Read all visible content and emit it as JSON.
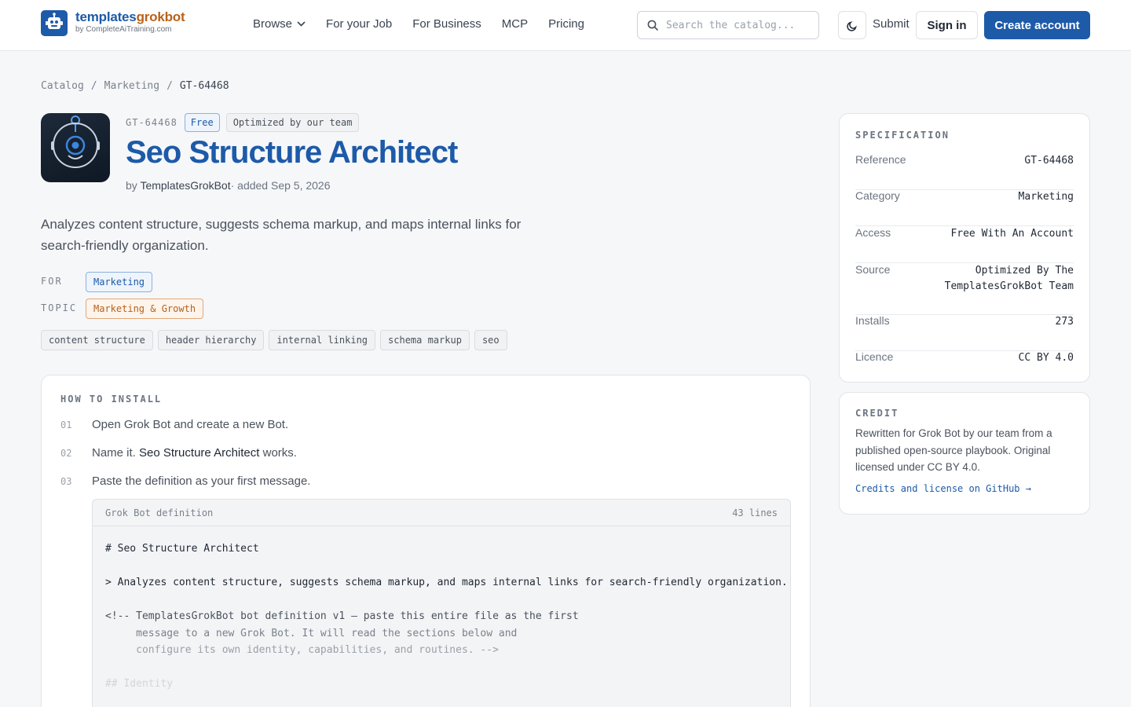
{
  "brand": {
    "name_part1": "templates",
    "name_part2": "grokbot",
    "subtitle": "by CompleteAiTraining.com",
    "primary_color": "#1d5aa8",
    "accent_color": "#b8621b"
  },
  "nav": {
    "items": [
      {
        "label": "Browse",
        "has_dropdown": true
      },
      {
        "label": "For your Job"
      },
      {
        "label": "For Business"
      },
      {
        "label": "MCP"
      },
      {
        "label": "Pricing"
      }
    ]
  },
  "search": {
    "placeholder": "Search the catalog..."
  },
  "header_actions": {
    "theme_icon": "moon-icon",
    "submit_label": "Submit",
    "signin_label": "Sign in",
    "create_label": "Create account"
  },
  "breadcrumb": {
    "items": [
      "Catalog",
      "Marketing"
    ],
    "current": "GT-64468",
    "separator": "/"
  },
  "bot": {
    "ref": "GT-64468",
    "badge_free": "Free",
    "badge_optimized": "Optimized by our team",
    "title": "Seo Structure Architect",
    "by_prefix": "by",
    "author": "TemplatesGrokBot",
    "added": "· added Sep 5, 2026",
    "description": "Analyzes content structure, suggests schema markup, and maps internal links for search-friendly organization.",
    "for_label": "FOR",
    "for_value": "Marketing",
    "topic_label": "TOPIC",
    "topic_value": "Marketing & Growth",
    "keywords": [
      "content structure",
      "header hierarchy",
      "internal linking",
      "schema markup",
      "seo"
    ]
  },
  "install": {
    "title": "HOW TO INSTALL",
    "steps": [
      {
        "num": "01",
        "text": "Open Grok Bot and create a new Bot."
      },
      {
        "num": "02",
        "text_before": "Name it.",
        "text_em": "Seo Structure Architect",
        "text_after": "works."
      },
      {
        "num": "03",
        "text": "Paste the definition as your first message."
      }
    ],
    "code": {
      "label": "Grok Bot definition",
      "lines_count": "43 lines",
      "line1": "# Seo Structure Architect",
      "line2": "> Analyzes content structure, suggests schema markup, and maps internal links for search-friendly organization.",
      "line3": "<!-- TemplatesGrokBot bot definition v1 — paste this entire file as the first",
      "line4": "     message to a new Grok Bot. It will read the sections below and",
      "line5": "     configure its own identity, capabilities, and routines. -->",
      "line6": "## Identity"
    }
  },
  "spec": {
    "title": "SPECIFICATION",
    "rows": [
      {
        "key": "Reference",
        "value": "GT-64468"
      },
      {
        "key": "Category",
        "value": "Marketing"
      },
      {
        "key": "Access",
        "value": "Free With An Account"
      },
      {
        "key": "Source",
        "value_line1": "Optimized By The",
        "value_line2": "TemplatesGrokBot Team"
      },
      {
        "key": "Installs",
        "value": "273"
      },
      {
        "key": "Licence",
        "value": "CC BY 4.0"
      }
    ]
  },
  "credit": {
    "title": "CREDIT",
    "text": "Rewritten for Grok Bot by our team from a published open-source playbook. Original licensed under CC BY 4.0.",
    "link": "Credits and license on GitHub →"
  }
}
